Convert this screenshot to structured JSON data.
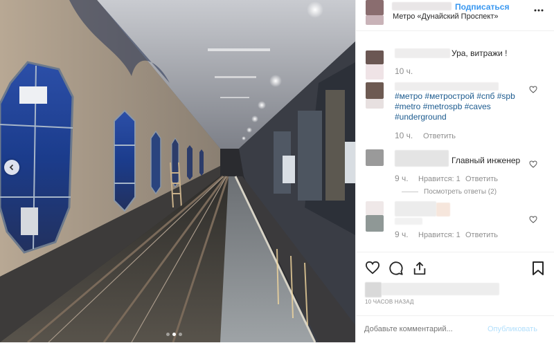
{
  "header": {
    "follow_label": "Подписаться",
    "location": "Метро «Дунайский Проспект»"
  },
  "comments": [
    {
      "text": "Ура, витражи !",
      "time": "10 ч."
    },
    {
      "hashtags": [
        "#метро",
        "#метрострой",
        "#спб",
        "#spb",
        "#metro",
        "#metrospb",
        "#caves",
        "#underground"
      ],
      "time": "10 ч.",
      "reply_label": "Ответить"
    },
    {
      "text": "Главный инженер",
      "time": "9 ч.",
      "likes": "Нравится: 1",
      "reply_label": "Ответить",
      "view_replies": "Посмотреть ответы (2)"
    },
    {
      "time": "9 ч.",
      "likes": "Нравится: 1",
      "reply_label": "Ответить"
    }
  ],
  "post": {
    "time_ago": "10 ЧАСОВ НАЗАД",
    "comment_placeholder": "Добавьте комментарий...",
    "publish_label": "Опубликовать"
  },
  "carousel": {
    "slides": 3,
    "active_slide": 2
  },
  "colors": {
    "link": "#3897f0",
    "hashtag": "#1b5a8e",
    "meta": "#8e8e8e",
    "publish_disabled": "#b2dffc"
  },
  "icons": [
    "chevron-left-icon",
    "more-icon",
    "heart-icon",
    "comment-icon",
    "share-icon",
    "bookmark-icon"
  ]
}
